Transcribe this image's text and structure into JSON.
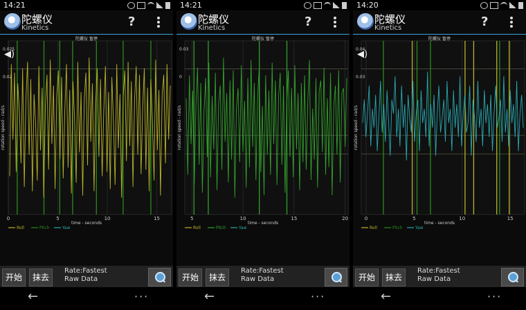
{
  "screens": [
    {
      "status_time": "14:21",
      "app_title": "陀螺仪",
      "app_subtitle": "Kinetics",
      "help_symbol": "?",
      "chart_header": "陀螺仪 暂停",
      "ylabel": "rotation speed - rad/s",
      "xlabel": "time - seconds",
      "x_ticks": [
        "0",
        "5",
        "10",
        "15"
      ],
      "y_ticks": [
        "0.025",
        "0.02"
      ],
      "legend": [
        "Roll",
        "Pitch",
        "Yaw"
      ],
      "btn_start": "开始",
      "btn_clear": "抹去",
      "rate": "Rate:Fastest",
      "raw": "Raw Data",
      "back_symbol": "←",
      "more_symbol": "···",
      "chart_data": {
        "type": "line",
        "xlim": [
          0,
          16.5
        ],
        "dominant_series": "Roll",
        "series": [
          {
            "name": "Roll",
            "color": "#b8b42a",
            "values": [
              -0.021,
              0.031,
              -0.004,
              0.027,
              -0.019,
              0.022,
              0.008,
              -0.015,
              0.029,
              -0.026,
              0.014,
              0.032,
              -0.011,
              0.024,
              -0.028,
              0.017,
              0.003,
              -0.023,
              0.03,
              -0.009,
              0.02,
              -0.031,
              0.012,
              0.026,
              -0.018,
              0.033,
              -0.006,
              0.021,
              -0.027,
              0.016,
              0.028,
              -0.013,
              0.025,
              -0.022,
              0.01,
              0.031,
              -0.017,
              0.019,
              -0.029,
              0.023,
              0.006,
              -0.024,
              0.032,
              -0.01,
              0.018,
              -0.03,
              0.015,
              0.027,
              -0.016,
              0.034,
              -0.005,
              0.022,
              -0.028,
              0.013,
              0.029,
              -0.012,
              0.024,
              -0.021,
              0.009,
              0.03,
              -0.019,
              0.018,
              -0.027,
              0.025,
              0.004,
              -0.025,
              0.031,
              -0.008,
              0.017,
              -0.031,
              0.016,
              0.028,
              -0.014,
              0.032,
              -0.007,
              0.023,
              -0.026,
              0.014,
              0.03,
              -0.011,
              0.026,
              -0.02,
              0.011,
              0.029,
              -0.018,
              0.02,
              -0.028,
              0.024,
              0.005,
              -0.023,
              0.033,
              -0.009,
              0.019,
              -0.03,
              0.017,
              0.026,
              -0.015,
              0.031,
              -0.004,
              0.021
            ]
          },
          {
            "name": "Pitch",
            "color": "#2c8a1c",
            "spikes_x": [
              0.9,
              3.6,
              5.2,
              6.5,
              8.9,
              11.6,
              14.4
            ]
          },
          {
            "name": "Yaw",
            "color": "#2aa8a0"
          }
        ]
      }
    },
    {
      "status_time": "14:21",
      "app_title": "陀螺仪",
      "app_subtitle": "Kinetics",
      "help_symbol": "?",
      "chart_header": "陀螺仪 暂停",
      "ylabel": "rotation speed - rad/s",
      "xlabel": "time - seconds",
      "x_ticks": [
        "5",
        "10",
        "15",
        "20"
      ],
      "y_ticks": [
        "0.03",
        "0"
      ],
      "legend": [
        "Roll",
        "Pitch",
        "Yaw"
      ],
      "btn_start": "开始",
      "btn_clear": "抹去",
      "rate": "Rate:Fastest",
      "raw": "Raw Data",
      "back_symbol": "←",
      "more_symbol": "···",
      "chart_data": {
        "type": "line",
        "xlim": [
          4.3,
          20.3
        ],
        "dominant_series": "Pitch",
        "series": [
          {
            "name": "Roll",
            "color": "#b8b42a"
          },
          {
            "name": "Pitch",
            "color": "#33a02c",
            "values": [
              0.012,
              -0.018,
              0.021,
              -0.006,
              0.015,
              -0.022,
              0.009,
              0.024,
              -0.014,
              0.018,
              -0.025,
              0.007,
              0.02,
              -0.011,
              0.026,
              -0.019,
              0.013,
              -0.008,
              0.022,
              -0.024,
              0.01,
              0.017,
              -0.016,
              0.028,
              -0.005,
              0.014,
              -0.021,
              0.019,
              -0.012,
              0.023,
              -0.027,
              0.008,
              0.016,
              -0.013,
              0.025,
              -0.009,
              0.011,
              -0.023,
              0.02,
              -0.015,
              0.027,
              -0.007,
              0.018,
              -0.02,
              0.012,
              0.024,
              -0.017,
              0.009,
              -0.026,
              0.021,
              -0.01,
              0.015,
              -0.018,
              0.026,
              -0.006,
              0.019,
              -0.022,
              0.013,
              0.022,
              -0.014,
              0.017,
              -0.025,
              0.01,
              0.023,
              -0.011,
              0.016,
              -0.019,
              0.025,
              -0.008,
              0.014,
              -0.024,
              0.018,
              -0.013,
              0.021,
              -0.016,
              0.011,
              0.027,
              -0.02,
              0.008,
              -0.012,
              0.02,
              -0.023,
              0.015,
              0.019,
              -0.009,
              0.024,
              -0.018,
              0.012,
              -0.015,
              0.022,
              -0.026,
              0.009,
              0.017,
              -0.01,
              0.023,
              -0.021,
              0.014,
              0.016,
              -0.007,
              0.02
            ]
          },
          {
            "name": "Yaw",
            "color": "#2aa8a0"
          }
        ],
        "spikes_x": [
          5.2,
          6.6,
          11.6,
          14.3
        ]
      }
    },
    {
      "status_time": "14:20",
      "app_title": "陀螺仪",
      "app_subtitle": "Kinetics",
      "help_symbol": "?",
      "chart_header": "陀螺仪 暂停",
      "ylabel": "rotation speed - rad/s",
      "xlabel": "time - seconds",
      "x_ticks": [
        "0",
        "5",
        "10",
        "15"
      ],
      "y_ticks": [
        "0.04",
        "0.03"
      ],
      "legend": [
        "Roll",
        "Pitch",
        "Yaw"
      ],
      "btn_start": "开始",
      "btn_clear": "抹去",
      "rate": "Rate:Fastest",
      "raw": "Raw Data",
      "back_symbol": "←",
      "more_symbol": "···",
      "chart_data": {
        "type": "line",
        "xlim": [
          -0.5,
          16.5
        ],
        "dominant_series": "Yaw",
        "series": [
          {
            "name": "Roll",
            "color": "#b8b42a",
            "spikes_x": [
              4.8,
              10.3,
              11.2,
              13.6,
              14.9
            ]
          },
          {
            "name": "Pitch",
            "color": "#2c8a1c",
            "spikes_x": [
              1.8,
              5.3,
              6.7,
              13.9
            ]
          },
          {
            "name": "Yaw",
            "color": "#2aa8b0",
            "values": [
              0.036,
              0.041,
              0.033,
              0.038,
              0.044,
              0.031,
              0.039,
              0.035,
              0.042,
              0.03,
              0.037,
              0.045,
              0.034,
              0.04,
              0.032,
              0.043,
              0.036,
              0.029,
              0.041,
              0.038,
              0.046,
              0.033,
              0.039,
              0.031,
              0.044,
              0.035,
              0.04,
              0.028,
              0.042,
              0.037,
              0.034,
              0.045,
              0.032,
              0.038,
              0.041,
              0.03,
              0.043,
              0.036,
              0.039,
              0.033,
              0.047,
              0.031,
              0.04,
              0.035,
              0.042,
              0.029,
              0.038,
              0.044,
              0.034,
              0.037,
              0.041,
              0.032,
              0.045,
              0.036,
              0.039,
              0.03,
              0.043,
              0.035,
              0.04,
              0.033,
              0.046,
              0.031,
              0.038,
              0.042,
              0.034,
              0.036,
              0.044,
              0.029,
              0.041,
              0.037,
              0.032,
              0.045,
              0.035,
              0.039,
              0.031,
              0.043,
              0.036,
              0.04,
              0.033,
              0.042,
              0.03,
              0.038,
              0.044,
              0.035,
              0.037,
              0.041,
              0.032,
              0.046,
              0.034,
              0.039,
              0.031,
              0.043,
              0.036,
              0.04,
              0.033,
              0.045,
              0.03,
              0.038,
              0.042,
              0.035
            ]
          }
        ],
        "ylim": [
          0.02,
          0.05
        ]
      }
    }
  ]
}
